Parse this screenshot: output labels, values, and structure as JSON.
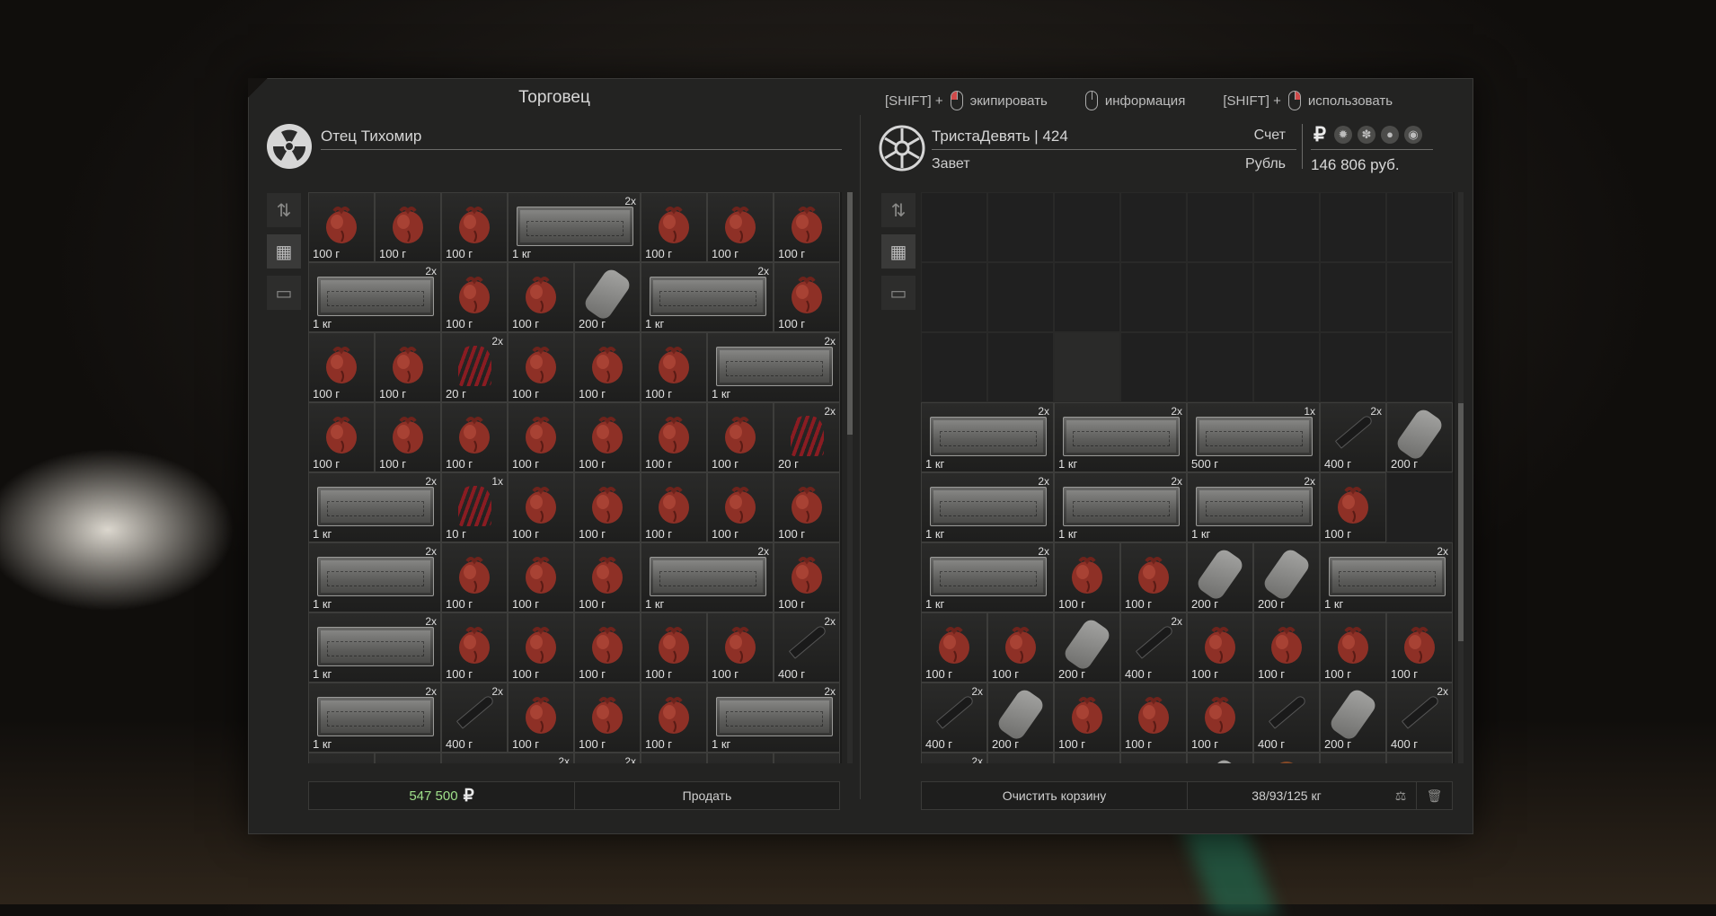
{
  "merchant": {
    "title": "Торговец",
    "name": "Отец Тихомир"
  },
  "hints": [
    {
      "prefix": "[SHIFT] +",
      "label": "экипировать",
      "button": "left"
    },
    {
      "prefix": "",
      "label": "информация",
      "button": "none"
    },
    {
      "prefix": "[SHIFT] +",
      "label": "использовать",
      "button": "right"
    }
  ],
  "player": {
    "name": "ТристаДевять  |  424",
    "faction": "Завет",
    "account_label": "Счет",
    "currency_label": "Рубль",
    "currency_symbol": "₽",
    "money": "146 806 руб.",
    "currency_icons": [
      "rub-icon",
      "gear-icon",
      "leaf-icon",
      "seed-icon",
      "coin-icon"
    ]
  },
  "sidebar_icons": [
    "sort-icon",
    "grid-icon",
    "box-icon"
  ],
  "trader_grid": {
    "cols": 8,
    "rows": 9,
    "items": [
      {
        "c": 0,
        "r": 0,
        "w": 1,
        "h": 1,
        "kind": "heart",
        "weight": "100 г",
        "qty": ""
      },
      {
        "c": 1,
        "r": 0,
        "w": 1,
        "h": 1,
        "kind": "heart",
        "weight": "100 г",
        "qty": ""
      },
      {
        "c": 2,
        "r": 0,
        "w": 1,
        "h": 1,
        "kind": "heart",
        "weight": "100 г",
        "qty": ""
      },
      {
        "c": 3,
        "r": 0,
        "w": 2,
        "h": 1,
        "kind": "crate",
        "weight": "1 кг",
        "qty": "2x"
      },
      {
        "c": 5,
        "r": 0,
        "w": 1,
        "h": 1,
        "kind": "heart",
        "weight": "100 г",
        "qty": ""
      },
      {
        "c": 6,
        "r": 0,
        "w": 1,
        "h": 1,
        "kind": "heart",
        "weight": "100 г",
        "qty": ""
      },
      {
        "c": 7,
        "r": 0,
        "w": 1,
        "h": 1,
        "kind": "heart",
        "weight": "100 г",
        "qty": ""
      },
      {
        "c": 0,
        "r": 1,
        "w": 2,
        "h": 1,
        "kind": "crate",
        "weight": "1 кг",
        "qty": "2x"
      },
      {
        "c": 2,
        "r": 1,
        "w": 1,
        "h": 1,
        "kind": "heart",
        "weight": "100 г",
        "qty": ""
      },
      {
        "c": 3,
        "r": 1,
        "w": 1,
        "h": 1,
        "kind": "heart",
        "weight": "100 г",
        "qty": ""
      },
      {
        "c": 4,
        "r": 1,
        "w": 1,
        "h": 1,
        "kind": "tool",
        "weight": "200 г",
        "qty": ""
      },
      {
        "c": 5,
        "r": 1,
        "w": 2,
        "h": 1,
        "kind": "crate",
        "weight": "1 кг",
        "qty": "2x"
      },
      {
        "c": 7,
        "r": 1,
        "w": 1,
        "h": 1,
        "kind": "heart",
        "weight": "100 г",
        "qty": ""
      },
      {
        "c": 0,
        "r": 2,
        "w": 1,
        "h": 1,
        "kind": "heart",
        "weight": "100 г",
        "qty": ""
      },
      {
        "c": 1,
        "r": 2,
        "w": 1,
        "h": 1,
        "kind": "heart",
        "weight": "100 г",
        "qty": ""
      },
      {
        "c": 2,
        "r": 2,
        "w": 1,
        "h": 1,
        "kind": "plant",
        "weight": "20 г",
        "qty": "2x"
      },
      {
        "c": 3,
        "r": 2,
        "w": 1,
        "h": 1,
        "kind": "heart",
        "weight": "100 г",
        "qty": ""
      },
      {
        "c": 4,
        "r": 2,
        "w": 1,
        "h": 1,
        "kind": "heart",
        "weight": "100 г",
        "qty": ""
      },
      {
        "c": 5,
        "r": 2,
        "w": 1,
        "h": 1,
        "kind": "heart",
        "weight": "100 г",
        "qty": ""
      },
      {
        "c": 6,
        "r": 2,
        "w": 2,
        "h": 1,
        "kind": "crate",
        "weight": "1 кг",
        "qty": "2x"
      },
      {
        "c": 0,
        "r": 3,
        "w": 1,
        "h": 1,
        "kind": "heart",
        "weight": "100 г",
        "qty": ""
      },
      {
        "c": 1,
        "r": 3,
        "w": 1,
        "h": 1,
        "kind": "heart",
        "weight": "100 г",
        "qty": ""
      },
      {
        "c": 2,
        "r": 3,
        "w": 1,
        "h": 1,
        "kind": "heart",
        "weight": "100 г",
        "qty": ""
      },
      {
        "c": 3,
        "r": 3,
        "w": 1,
        "h": 1,
        "kind": "heart",
        "weight": "100 г",
        "qty": ""
      },
      {
        "c": 4,
        "r": 3,
        "w": 1,
        "h": 1,
        "kind": "heart",
        "weight": "100 г",
        "qty": ""
      },
      {
        "c": 5,
        "r": 3,
        "w": 1,
        "h": 1,
        "kind": "heart",
        "weight": "100 г",
        "qty": ""
      },
      {
        "c": 6,
        "r": 3,
        "w": 1,
        "h": 1,
        "kind": "heart",
        "weight": "100 г",
        "qty": ""
      },
      {
        "c": 7,
        "r": 3,
        "w": 1,
        "h": 1,
        "kind": "plant",
        "weight": "20 г",
        "qty": "2x"
      },
      {
        "c": 0,
        "r": 4,
        "w": 2,
        "h": 1,
        "kind": "crate",
        "weight": "1 кг",
        "qty": "2x"
      },
      {
        "c": 2,
        "r": 4,
        "w": 1,
        "h": 1,
        "kind": "plant",
        "weight": "10 г",
        "qty": "1x"
      },
      {
        "c": 3,
        "r": 4,
        "w": 1,
        "h": 1,
        "kind": "heart",
        "weight": "100 г",
        "qty": ""
      },
      {
        "c": 4,
        "r": 4,
        "w": 1,
        "h": 1,
        "kind": "heart",
        "weight": "100 г",
        "qty": ""
      },
      {
        "c": 5,
        "r": 4,
        "w": 1,
        "h": 1,
        "kind": "heart",
        "weight": "100 г",
        "qty": ""
      },
      {
        "c": 6,
        "r": 4,
        "w": 1,
        "h": 1,
        "kind": "heart",
        "weight": "100 г",
        "qty": ""
      },
      {
        "c": 7,
        "r": 4,
        "w": 1,
        "h": 1,
        "kind": "heart",
        "weight": "100 г",
        "qty": ""
      },
      {
        "c": 0,
        "r": 5,
        "w": 2,
        "h": 1,
        "kind": "crate",
        "weight": "1 кг",
        "qty": "2x"
      },
      {
        "c": 2,
        "r": 5,
        "w": 1,
        "h": 1,
        "kind": "heart",
        "weight": "100 г",
        "qty": ""
      },
      {
        "c": 3,
        "r": 5,
        "w": 1,
        "h": 1,
        "kind": "heart",
        "weight": "100 г",
        "qty": ""
      },
      {
        "c": 4,
        "r": 5,
        "w": 1,
        "h": 1,
        "kind": "heart",
        "weight": "100 г",
        "qty": ""
      },
      {
        "c": 5,
        "r": 5,
        "w": 2,
        "h": 1,
        "kind": "crate",
        "weight": "1 кг",
        "qty": "2x"
      },
      {
        "c": 7,
        "r": 5,
        "w": 1,
        "h": 1,
        "kind": "heart",
        "weight": "100 г",
        "qty": ""
      },
      {
        "c": 0,
        "r": 6,
        "w": 2,
        "h": 1,
        "kind": "crate",
        "weight": "1 кг",
        "qty": "2x"
      },
      {
        "c": 2,
        "r": 6,
        "w": 1,
        "h": 1,
        "kind": "heart",
        "weight": "100 г",
        "qty": ""
      },
      {
        "c": 3,
        "r": 6,
        "w": 1,
        "h": 1,
        "kind": "heart",
        "weight": "100 г",
        "qty": ""
      },
      {
        "c": 4,
        "r": 6,
        "w": 1,
        "h": 1,
        "kind": "heart",
        "weight": "100 г",
        "qty": ""
      },
      {
        "c": 5,
        "r": 6,
        "w": 1,
        "h": 1,
        "kind": "heart",
        "weight": "100 г",
        "qty": ""
      },
      {
        "c": 6,
        "r": 6,
        "w": 1,
        "h": 1,
        "kind": "heart",
        "weight": "100 г",
        "qty": ""
      },
      {
        "c": 7,
        "r": 6,
        "w": 1,
        "h": 1,
        "kind": "knife",
        "weight": "400 г",
        "qty": "2x"
      },
      {
        "c": 0,
        "r": 7,
        "w": 2,
        "h": 1,
        "kind": "crate",
        "weight": "1 кг",
        "qty": "2x"
      },
      {
        "c": 2,
        "r": 7,
        "w": 1,
        "h": 1,
        "kind": "knife",
        "weight": "400 г",
        "qty": "2x"
      },
      {
        "c": 3,
        "r": 7,
        "w": 1,
        "h": 1,
        "kind": "heart",
        "weight": "100 г",
        "qty": ""
      },
      {
        "c": 4,
        "r": 7,
        "w": 1,
        "h": 1,
        "kind": "heart",
        "weight": "100 г",
        "qty": ""
      },
      {
        "c": 5,
        "r": 7,
        "w": 1,
        "h": 1,
        "kind": "heart",
        "weight": "100 г",
        "qty": ""
      },
      {
        "c": 6,
        "r": 7,
        "w": 2,
        "h": 1,
        "kind": "crate",
        "weight": "1 кг",
        "qty": "2x"
      },
      {
        "c": 0,
        "r": 8,
        "w": 1,
        "h": 1,
        "kind": "heart",
        "weight": "",
        "qty": ""
      },
      {
        "c": 1,
        "r": 8,
        "w": 1,
        "h": 1,
        "kind": "heart",
        "weight": "",
        "qty": ""
      },
      {
        "c": 2,
        "r": 8,
        "w": 2,
        "h": 1,
        "kind": "crate",
        "weight": "",
        "qty": "2x"
      },
      {
        "c": 4,
        "r": 8,
        "w": 1,
        "h": 1,
        "kind": "knife",
        "weight": "",
        "qty": "2x"
      },
      {
        "c": 5,
        "r": 8,
        "w": 1,
        "h": 1,
        "kind": "heart",
        "weight": "",
        "qty": ""
      },
      {
        "c": 6,
        "r": 8,
        "w": 1,
        "h": 1,
        "kind": "heart",
        "weight": "",
        "qty": ""
      },
      {
        "c": 7,
        "r": 8,
        "w": 1,
        "h": 1,
        "kind": "heart",
        "weight": "",
        "qty": ""
      }
    ]
  },
  "cart_grid": {
    "cols": 8,
    "rows": 9,
    "empty_rows": 3,
    "items": [
      {
        "c": 0,
        "r": 3,
        "w": 2,
        "h": 1,
        "kind": "crate",
        "weight": "1 кг",
        "qty": "2x"
      },
      {
        "c": 2,
        "r": 3,
        "w": 2,
        "h": 1,
        "kind": "crate",
        "weight": "1 кг",
        "qty": "2x"
      },
      {
        "c": 4,
        "r": 3,
        "w": 2,
        "h": 1,
        "kind": "crate",
        "weight": "500 г",
        "qty": "1x"
      },
      {
        "c": 6,
        "r": 3,
        "w": 1,
        "h": 1,
        "kind": "knife",
        "weight": "400 г",
        "qty": "2x"
      },
      {
        "c": 7,
        "r": 3,
        "w": 1,
        "h": 1,
        "kind": "tool",
        "weight": "200 г",
        "qty": ""
      },
      {
        "c": 0,
        "r": 4,
        "w": 2,
        "h": 1,
        "kind": "crate",
        "weight": "1 кг",
        "qty": "2x"
      },
      {
        "c": 2,
        "r": 4,
        "w": 2,
        "h": 1,
        "kind": "crate",
        "weight": "1 кг",
        "qty": "2x"
      },
      {
        "c": 4,
        "r": 4,
        "w": 2,
        "h": 1,
        "kind": "crate",
        "weight": "1 кг",
        "qty": "2x"
      },
      {
        "c": 6,
        "r": 4,
        "w": 1,
        "h": 1,
        "kind": "heart",
        "weight": "100 г",
        "qty": ""
      },
      {
        "c": 0,
        "r": 5,
        "w": 2,
        "h": 1,
        "kind": "crate",
        "weight": "1 кг",
        "qty": "2x"
      },
      {
        "c": 2,
        "r": 5,
        "w": 1,
        "h": 1,
        "kind": "heart",
        "weight": "100 г",
        "qty": ""
      },
      {
        "c": 3,
        "r": 5,
        "w": 1,
        "h": 1,
        "kind": "heart",
        "weight": "100 г",
        "qty": ""
      },
      {
        "c": 4,
        "r": 5,
        "w": 1,
        "h": 1,
        "kind": "tool",
        "weight": "200 г",
        "qty": ""
      },
      {
        "c": 5,
        "r": 5,
        "w": 1,
        "h": 1,
        "kind": "tool",
        "weight": "200 г",
        "qty": ""
      },
      {
        "c": 6,
        "r": 5,
        "w": 2,
        "h": 1,
        "kind": "crate",
        "weight": "1 кг",
        "qty": "2x"
      },
      {
        "c": 0,
        "r": 6,
        "w": 1,
        "h": 1,
        "kind": "heart",
        "weight": "100 г",
        "qty": ""
      },
      {
        "c": 1,
        "r": 6,
        "w": 1,
        "h": 1,
        "kind": "heart",
        "weight": "100 г",
        "qty": ""
      },
      {
        "c": 2,
        "r": 6,
        "w": 1,
        "h": 1,
        "kind": "tool",
        "weight": "200 г",
        "qty": ""
      },
      {
        "c": 3,
        "r": 6,
        "w": 1,
        "h": 1,
        "kind": "knife",
        "weight": "400 г",
        "qty": "2x"
      },
      {
        "c": 4,
        "r": 6,
        "w": 1,
        "h": 1,
        "kind": "heart",
        "weight": "100 г",
        "qty": ""
      },
      {
        "c": 5,
        "r": 6,
        "w": 1,
        "h": 1,
        "kind": "heart",
        "weight": "100 г",
        "qty": ""
      },
      {
        "c": 6,
        "r": 6,
        "w": 1,
        "h": 1,
        "kind": "heart",
        "weight": "100 г",
        "qty": ""
      },
      {
        "c": 7,
        "r": 6,
        "w": 1,
        "h": 1,
        "kind": "heart",
        "weight": "100 г",
        "qty": ""
      },
      {
        "c": 0,
        "r": 7,
        "w": 1,
        "h": 1,
        "kind": "knife",
        "weight": "400 г",
        "qty": "2x"
      },
      {
        "c": 1,
        "r": 7,
        "w": 1,
        "h": 1,
        "kind": "tool",
        "weight": "200 г",
        "qty": ""
      },
      {
        "c": 2,
        "r": 7,
        "w": 1,
        "h": 1,
        "kind": "heart",
        "weight": "100 г",
        "qty": ""
      },
      {
        "c": 3,
        "r": 7,
        "w": 1,
        "h": 1,
        "kind": "heart",
        "weight": "100 г",
        "qty": ""
      },
      {
        "c": 4,
        "r": 7,
        "w": 1,
        "h": 1,
        "kind": "heart",
        "weight": "100 г",
        "qty": ""
      },
      {
        "c": 5,
        "r": 7,
        "w": 1,
        "h": 1,
        "kind": "knife",
        "weight": "400 г",
        "qty": ""
      },
      {
        "c": 6,
        "r": 7,
        "w": 1,
        "h": 1,
        "kind": "tool",
        "weight": "200 г",
        "qty": ""
      },
      {
        "c": 7,
        "r": 7,
        "w": 1,
        "h": 1,
        "kind": "knife",
        "weight": "400 г",
        "qty": "2x"
      },
      {
        "c": 0,
        "r": 8,
        "w": 1,
        "h": 1,
        "kind": "knife",
        "weight": "",
        "qty": "2x"
      },
      {
        "c": 1,
        "r": 8,
        "w": 1,
        "h": 1,
        "kind": "heart",
        "weight": "",
        "qty": ""
      },
      {
        "c": 2,
        "r": 8,
        "w": 1,
        "h": 1,
        "kind": "heart",
        "weight": "",
        "qty": ""
      },
      {
        "c": 3,
        "r": 8,
        "w": 1,
        "h": 1,
        "kind": "heart",
        "weight": "",
        "qty": ""
      },
      {
        "c": 4,
        "r": 8,
        "w": 1,
        "h": 1,
        "kind": "tool",
        "weight": "",
        "qty": ""
      },
      {
        "c": 5,
        "r": 8,
        "w": 1,
        "h": 1,
        "kind": "sack",
        "weight": "",
        "qty": ""
      },
      {
        "c": 6,
        "r": 8,
        "w": 1,
        "h": 1,
        "kind": "heart",
        "weight": "",
        "qty": ""
      },
      {
        "c": 7,
        "r": 8,
        "w": 1,
        "h": 1,
        "kind": "heart",
        "weight": "",
        "qty": ""
      }
    ]
  },
  "trader_footer": {
    "total": "547 500",
    "currency": "₽",
    "sell_label": "Продать"
  },
  "cart_footer": {
    "clear_label": "Очистить корзину",
    "weight": "38/93/125 кг"
  },
  "colors": {
    "accent_total": "#9fe08a",
    "heart": "#8e3026",
    "background": "#232322"
  }
}
